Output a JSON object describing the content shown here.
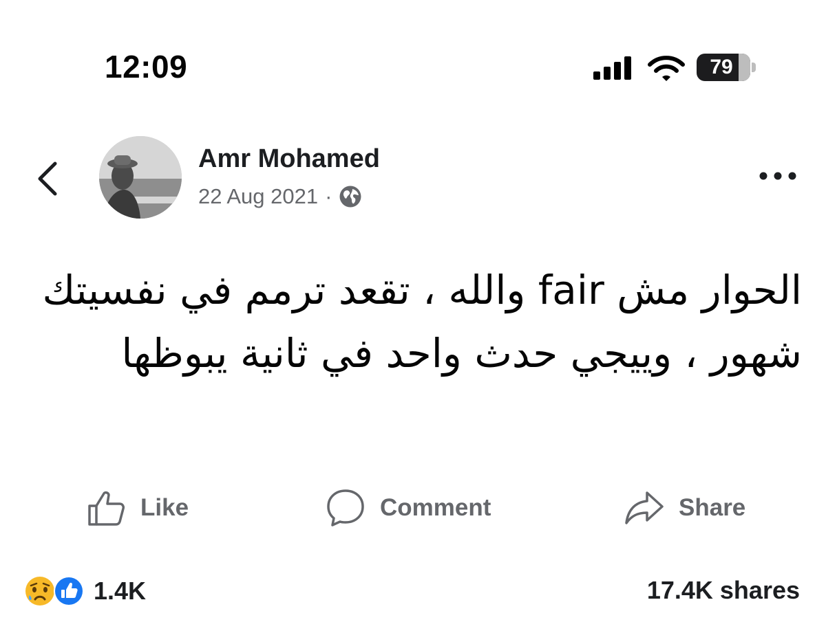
{
  "status_bar": {
    "time": "12:09",
    "battery": "79",
    "icons": [
      "signal-icon",
      "wifi-icon",
      "battery-icon"
    ]
  },
  "header": {
    "back_icon": "chevron-left-icon",
    "author": "Amr Mohamed",
    "date": "22 Aug 2021",
    "separator": "·",
    "audience_icon": "globe-icon",
    "more_icon": "more-horizontal-icon"
  },
  "post": {
    "text": "الحوار مش fair والله ، تقعد ترمم في نفسيتك شهور ، وييجي حدث واحد في ثانية يبوظها"
  },
  "actions": {
    "like": {
      "label": "Like",
      "icon": "thumbs-up-icon"
    },
    "comment": {
      "label": "Comment",
      "icon": "comment-bubble-icon"
    },
    "share": {
      "label": "Share",
      "icon": "share-arrow-icon"
    }
  },
  "footer": {
    "reactions": [
      "sad-face-icon",
      "like-reaction-icon"
    ],
    "reaction_count": "1.4K",
    "shares": "17.4K shares"
  },
  "colors": {
    "text": "#050505",
    "secondary": "#65676b",
    "like_blue": "#1877f2",
    "sad_yellow": "#f7b928"
  }
}
